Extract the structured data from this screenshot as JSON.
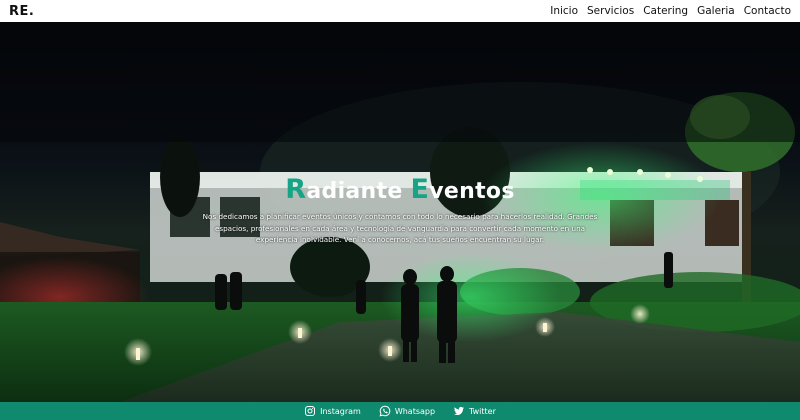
{
  "brand": {
    "logo": "RE."
  },
  "nav": {
    "items": [
      "Inicio",
      "Servicios",
      "Catering",
      "Galeria",
      "Contacto"
    ]
  },
  "hero": {
    "title_first_letter": "R",
    "title_first_rest": "adiante ",
    "title_second_letter": "E",
    "title_second_rest": "ventos",
    "description": "Nos dedicamos a planificar eventos únicos y contamos con todo lo necesario para hacerlos realidad. Grandes espacios, profesionales en cada área y tecnología de vanguardia para convertir cada momento en una experiencia inolvidable. Vení a conocernos, acá tus sueños encuentran su lugar.",
    "background_image": "night-garden-event-venue"
  },
  "footer": {
    "links": [
      {
        "label": "Instagram",
        "icon": "instagram-icon"
      },
      {
        "label": "Whatsapp",
        "icon": "whatsapp-icon"
      },
      {
        "label": "Twitter",
        "icon": "twitter-icon"
      }
    ]
  },
  "colors": {
    "accent": "#15a586",
    "footer_bg": "#0f8a6e",
    "navbar_bg": "#ffffff"
  }
}
